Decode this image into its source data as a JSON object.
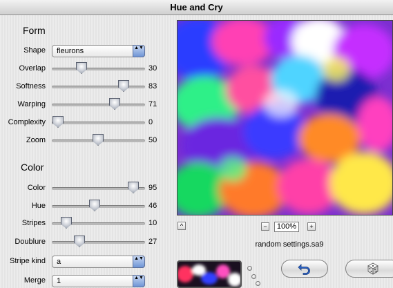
{
  "window": {
    "title": "Hue and Cry"
  },
  "form": {
    "heading": "Form",
    "shape": {
      "label": "Shape",
      "value": "fleurons"
    },
    "sliders": [
      {
        "label": "Overlap",
        "value": "30"
      },
      {
        "label": "Softness",
        "value": "83"
      },
      {
        "label": "Warping",
        "value": "71"
      },
      {
        "label": "Complexity",
        "value": "0"
      },
      {
        "label": "Zoom",
        "value": "50"
      }
    ]
  },
  "color": {
    "heading": "Color",
    "sliders": [
      {
        "label": "Color",
        "value": "95"
      },
      {
        "label": "Hue",
        "value": "46"
      },
      {
        "label": "Stripes",
        "value": "10"
      },
      {
        "label": "Doublure",
        "value": "27"
      }
    ],
    "stripe_kind": {
      "label": "Stripe kind",
      "value": "a"
    },
    "merge": {
      "label": "Merge",
      "value": "1"
    }
  },
  "preview": {
    "zoom_out": "−",
    "zoom_level": "100%",
    "zoom_in": "+",
    "collapse_glyph": "^",
    "filename": "random settings.sa9"
  },
  "icons": {
    "popup_arrows": "▲▼",
    "undo": "undo-icon",
    "randomize": "dice-icon"
  },
  "accent_colors": {
    "popup_arrow_blue": "#6f95d6",
    "undo_blue": "#2c63c8"
  }
}
